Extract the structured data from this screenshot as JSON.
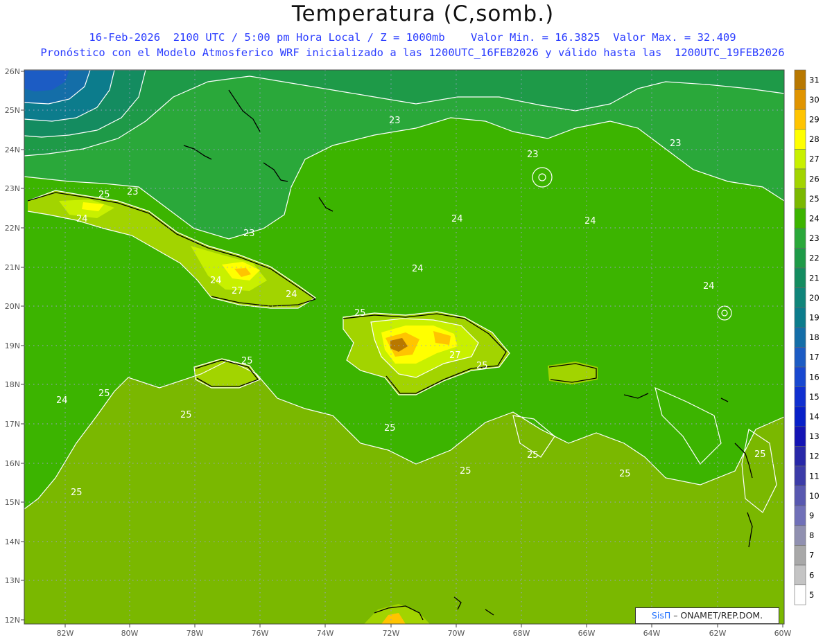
{
  "title": "Temperatura (C,somb.)",
  "subtitle_line1": "16-Feb-2026  2100 UTC / 5:00 pm Hora Local / Z = 1000mb    Valor Min. = 16.3825  Valor Max. = 32.409",
  "subtitle_line2": "Pronóstico con el Modelo Atmosferico WRF inicializado a las 1200UTC_16FEB2026 y válido hasta las  1200UTC_19FEB2026",
  "map": {
    "lon_labels": [
      "82W",
      "80W",
      "78W",
      "76W",
      "74W",
      "72W",
      "70W",
      "68W",
      "66W",
      "64W",
      "62W",
      "60W"
    ],
    "lat_labels": [
      "26N",
      "25N",
      "24N",
      "23N",
      "22N",
      "21N",
      "20N",
      "19N",
      "18N",
      "17N",
      "16N",
      "15N",
      "14N",
      "13N",
      "12N"
    ],
    "contour_labels": [
      "23",
      "23",
      "23",
      "23",
      "24",
      "24",
      "24",
      "24",
      "24",
      "24",
      "24",
      "24",
      "25",
      "25",
      "25",
      "25",
      "25",
      "25",
      "25",
      "25",
      "25",
      "25",
      "25",
      "25",
      "27",
      "27",
      "23"
    ],
    "colorbar": {
      "levels": [
        "31",
        "30",
        "29",
        "28",
        "27",
        "26",
        "25",
        "24",
        "23",
        "22",
        "21",
        "20",
        "19",
        "18",
        "17",
        "16",
        "15",
        "14",
        "13",
        "12",
        "11",
        "10",
        "9",
        "8",
        "7",
        "6",
        "5"
      ],
      "colors": [
        "#b87800",
        "#e09400",
        "#ffc400",
        "#ffff00",
        "#c8f000",
        "#a2d400",
        "#7ab800",
        "#3cb400",
        "#2aa83a",
        "#1e9a48",
        "#148c60",
        "#10857a",
        "#0c7c8c",
        "#146ea8",
        "#1c5cc4",
        "#1848d0",
        "#1030d0",
        "#0820c8",
        "#1414b4",
        "#2828a8",
        "#3c3ca8",
        "#5858b0",
        "#7070b8",
        "#9090b0",
        "#a8a8a8",
        "#c4c4c4",
        "#ffffff"
      ]
    }
  },
  "credit": {
    "brand": "SisΠ",
    "org": " – ONAMET/REP.DOM."
  }
}
